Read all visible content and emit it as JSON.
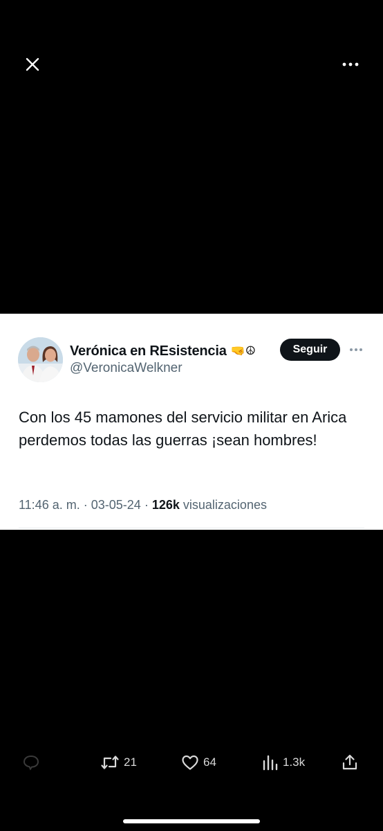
{
  "topbar": {
    "close_icon": "close-icon",
    "more_icon": "more-horizontal-icon"
  },
  "tweet": {
    "author": {
      "display_name": "Verónica en REsistencia",
      "name_emojis": "🤜☮",
      "handle": "@VeronicaWelkner"
    },
    "follow_label": "Seguir",
    "text": "Con los 45 mamones del servicio militar en Arica perdemos todas las guerras ¡sean hombres!",
    "time": "11:46 a. m.",
    "separator": "·",
    "date": "03-05-24",
    "views_count": "126k",
    "views_label": "visualizaciones"
  },
  "actions": {
    "reply": {
      "icon": "reply-icon"
    },
    "retweet": {
      "icon": "retweet-icon",
      "count": "21"
    },
    "like": {
      "icon": "heart-icon",
      "count": "64"
    },
    "views": {
      "icon": "views-bar-chart-icon",
      "count": "1.3k"
    },
    "share": {
      "icon": "share-icon"
    }
  },
  "colors": {
    "background": "#000000",
    "card": "#ffffff",
    "text_primary": "#0f1419",
    "text_secondary": "#536471",
    "follow_button": "#0f1419",
    "action_icons": "#d9d9d9",
    "reply_icon_dim": "#3a3a3a"
  }
}
